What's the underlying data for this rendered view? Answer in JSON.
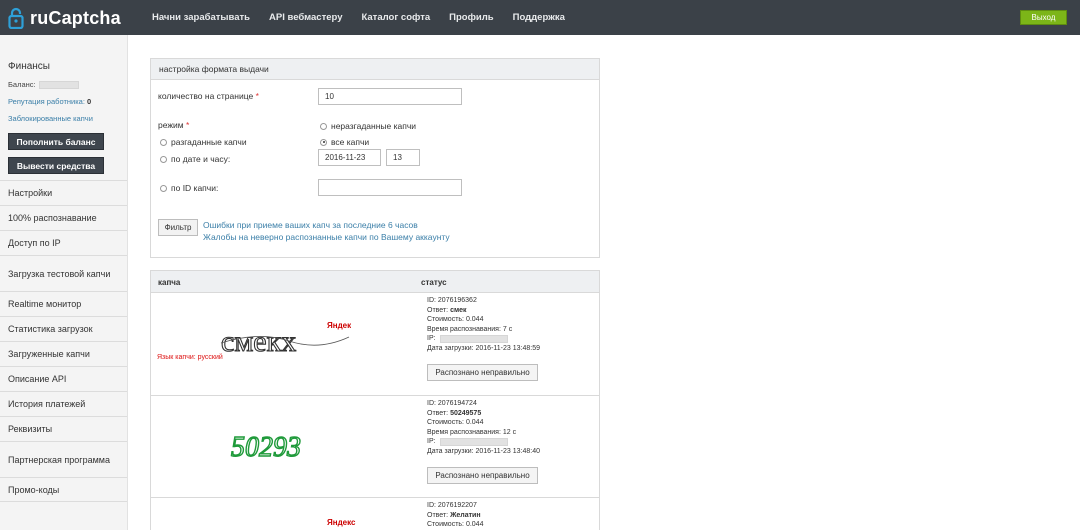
{
  "header": {
    "logo_text": "ruCaptcha",
    "nav": [
      "Начни зарабатывать",
      "API вебмастеру",
      "Каталог софта",
      "Профиль",
      "Поддержка"
    ],
    "logout": "Выход"
  },
  "sidebar": {
    "finance_title": "Финансы",
    "balance_label": "Баланс:",
    "reputation_label": "Репутация работника:",
    "reputation_value": "0",
    "blocked_link": "Заблокированные капчи",
    "topup_button": "Пополнить баланс",
    "withdraw_button": "Вывести средства",
    "menu": [
      "Настройки",
      "100% распознавание",
      "Доступ по IP",
      "Загрузка тестовой капчи",
      "Realtime монитор",
      "Статистика загрузок",
      "Загруженные капчи",
      "Описание API",
      "История платежей",
      "Реквизиты",
      "Партнерская программа",
      "Промо-коды"
    ]
  },
  "filter": {
    "title": "настройка формата выдачи",
    "per_page_label": "количество на странице",
    "per_page_value": "10",
    "mode_label": "режим",
    "required_mark": "*",
    "opt_unsolved": "неразгаданные капчи",
    "opt_solved": "разгаданные капчи",
    "opt_all": "все капчи",
    "opt_by_date": "по дате и часу:",
    "date_value": "2016-11-23",
    "hour_value": "13",
    "opt_by_id": "по ID капчи:",
    "id_value": "",
    "filter_button": "Фильтр",
    "link_errors": "Ошибки при приеме ваших капч за последние 6 часов",
    "link_complaints": "Жалобы на неверно распознанные капчи по Вашему аккаунту"
  },
  "table": {
    "col_captcha": "капча",
    "col_status": "статус",
    "rows": [
      {
        "id_label": "ID:",
        "id": "2076196362",
        "answer_label": "Ответ:",
        "answer": "смек",
        "cost_label": "Стоимость:",
        "cost": "0.044",
        "time_label": "Время распознавания:",
        "time": "7 с",
        "ip_label": "IP:",
        "date_label": "Дата загрузки:",
        "date": "2016-11-23 13:48:59",
        "lang": "Язык капчи: русский",
        "image_text": "смекх",
        "brand": "Яндекс",
        "report_button": "Распознано неправильно"
      },
      {
        "id_label": "ID:",
        "id": "2076194724",
        "answer_label": "Ответ:",
        "answer": "50249575",
        "cost_label": "Стоимость:",
        "cost": "0.044",
        "time_label": "Время распознавания:",
        "time": "12 с",
        "ip_label": "IP:",
        "date_label": "Дата загрузки:",
        "date": "2016-11-23 13:48:40",
        "image_text": "50293",
        "report_button": "Распознано неправильно"
      },
      {
        "id_label": "ID:",
        "id": "2076192207",
        "answer_label": "Ответ:",
        "answer": "Желатин",
        "cost_label": "Стоимость:",
        "cost": "0.044",
        "brand": "Яндекс"
      }
    ]
  },
  "colors": {
    "topbar": "#3b4148",
    "logout_green": "#7cb518",
    "link_blue": "#3b7fa8",
    "captcha_green": "#1f9a3a"
  }
}
